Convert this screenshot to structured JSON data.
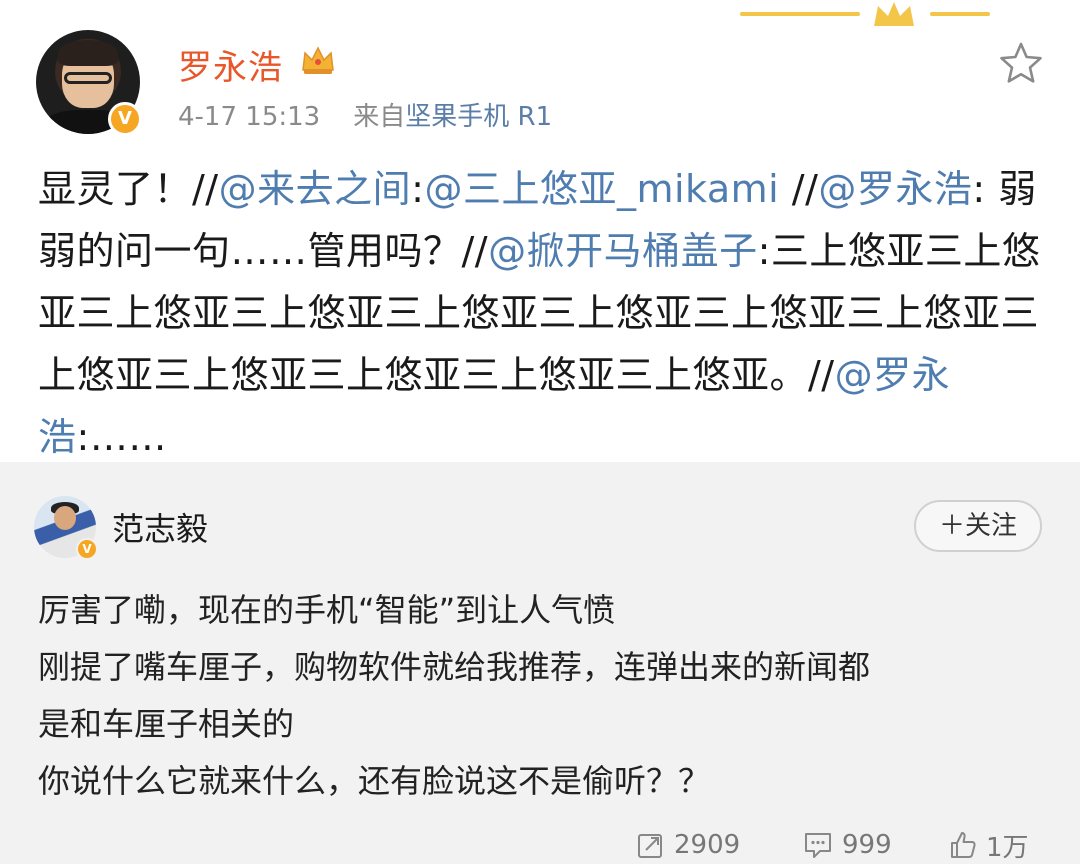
{
  "post": {
    "author": "罗永浩",
    "timestamp": "4-17 15:13",
    "source_prefix": "来自",
    "source_device": "坚果手机 R1",
    "text": {
      "part1": "显灵了！//",
      "mention1": "@来去之间",
      "part2": ":",
      "mention2": "@三上悠亚_mikami",
      "part3": " //",
      "mention3": "@罗永浩",
      "part4": ": 弱弱的问一句……管用吗？//",
      "mention4": "@掀开马桶盖子",
      "part5": ":三上悠亚三上悠亚三上悠亚三上悠亚三上悠亚三上悠亚三上悠亚三上悠亚三上悠亚三上悠亚三上悠亚三上悠亚三上悠亚。//",
      "mention5": "@罗永浩",
      "part6": ":……"
    }
  },
  "comment": {
    "author": "范志毅",
    "follow_label": "＋关注",
    "lines": [
      "厉害了嘞，现在的手机“智能”到让人气愤",
      "刚提了嘴车厘子，购物软件就给我推荐，连弹出来的新闻都",
      "是和车厘子相关的",
      "你说什么它就来什么，还有脸说这不是偷听？？"
    ]
  },
  "actions": {
    "repost_count": "2909",
    "comment_count": "999",
    "like_count": "1万"
  },
  "icons": {
    "verified": "verified-v-badge",
    "vip": "crown-icon",
    "favorite": "star-icon",
    "repost": "repost-icon",
    "comment": "comment-icon",
    "like": "thumbs-up-icon"
  },
  "colors": {
    "username": "#e8562a",
    "mention": "#4f7db0",
    "badge": "#f5a623",
    "comment_bg": "#f2f2f2"
  }
}
